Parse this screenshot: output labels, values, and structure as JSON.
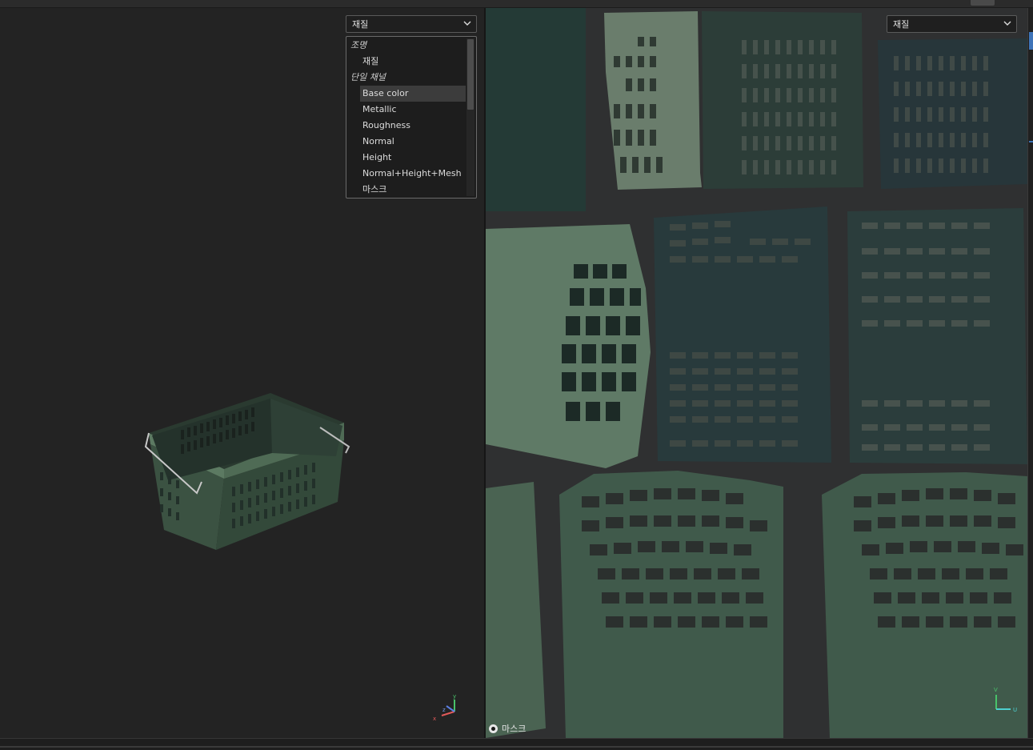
{
  "viewport_3d": {
    "view_select": {
      "value": "재질"
    },
    "dropdown": {
      "groups": [
        {
          "label": "조명",
          "items": [
            "재질"
          ]
        },
        {
          "label": "단일 채널",
          "items": [
            "Base color",
            "Metallic",
            "Roughness",
            "Normal",
            "Height",
            "Normal+Height+Mesh",
            "마스크"
          ]
        }
      ],
      "selected": "Base color"
    },
    "axis": {
      "x": "x",
      "y": "y",
      "z": "z"
    }
  },
  "viewport_uv": {
    "view_select": {
      "value": "재질"
    },
    "mask_label": "마스크",
    "axis": {
      "u": "U",
      "v": "V"
    }
  },
  "colors": {
    "texture_green": "#5f7a66",
    "texture_dark": "#2a3a34",
    "accent_blue": "#3e74b8"
  }
}
